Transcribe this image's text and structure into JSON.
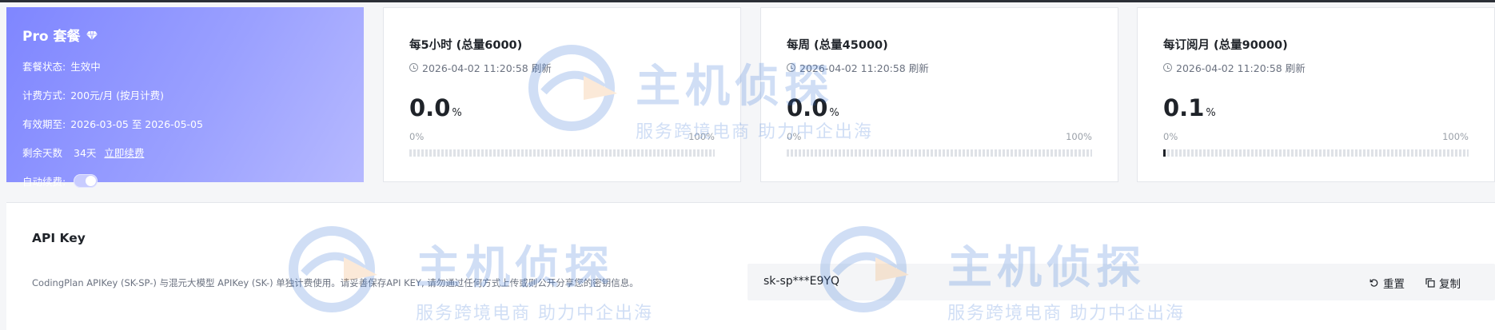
{
  "plan": {
    "title": "Pro 套餐",
    "status_label": "套餐状态:",
    "status_value": "生效中",
    "billing_label": "计费方式:",
    "billing_value": "200元/月 (按月计费)",
    "validity_label": "有效期至:",
    "validity_value": "2026-03-05 至 2026-05-05",
    "remaining_label": "剩余天数",
    "remaining_value": "34天",
    "renew_link": "立即续费",
    "auto_renew_label": "自动续费:",
    "auto_renew_on": true
  },
  "usage": [
    {
      "title": "每5小时 (总量6000)",
      "refresh": "2026-04-02 11:20:58 刷新",
      "value": "0.0",
      "unit": "%",
      "fraction": 0.0,
      "min_label": "0%",
      "max_label": "100%"
    },
    {
      "title": "每周 (总量45000)",
      "refresh": "2026-04-02 11:20:58 刷新",
      "value": "0.0",
      "unit": "%",
      "fraction": 0.0,
      "min_label": "0%",
      "max_label": "100%"
    },
    {
      "title": "每订阅月 (总量90000)",
      "refresh": "2026-04-02 11:20:58 刷新",
      "value": "0.1",
      "unit": "%",
      "fraction": 0.001,
      "min_label": "0%",
      "max_label": "100%"
    }
  ],
  "api": {
    "title": "API Key",
    "description": "CodingPlan APIKey (SK-SP-) 与混元大模型 APIKey (SK-) 单独计费使用。请妥善保存API KEY, 请勿通过任何方式上传或则公开分享您的密钥信息。",
    "key_value": "sk-sp***E9YQ",
    "reset_label": "重置",
    "copy_label": "复制"
  },
  "watermark": {
    "title": "主机侦探",
    "subtitle": "服务跨境电商  助力中企出海"
  },
  "colors": {
    "plan_gradient_start": "#7f86ff",
    "plan_gradient_end": "#b6b9ff",
    "text_primary": "#1f2329",
    "text_secondary": "#6b7280",
    "watermark": "#2d6fd6"
  }
}
